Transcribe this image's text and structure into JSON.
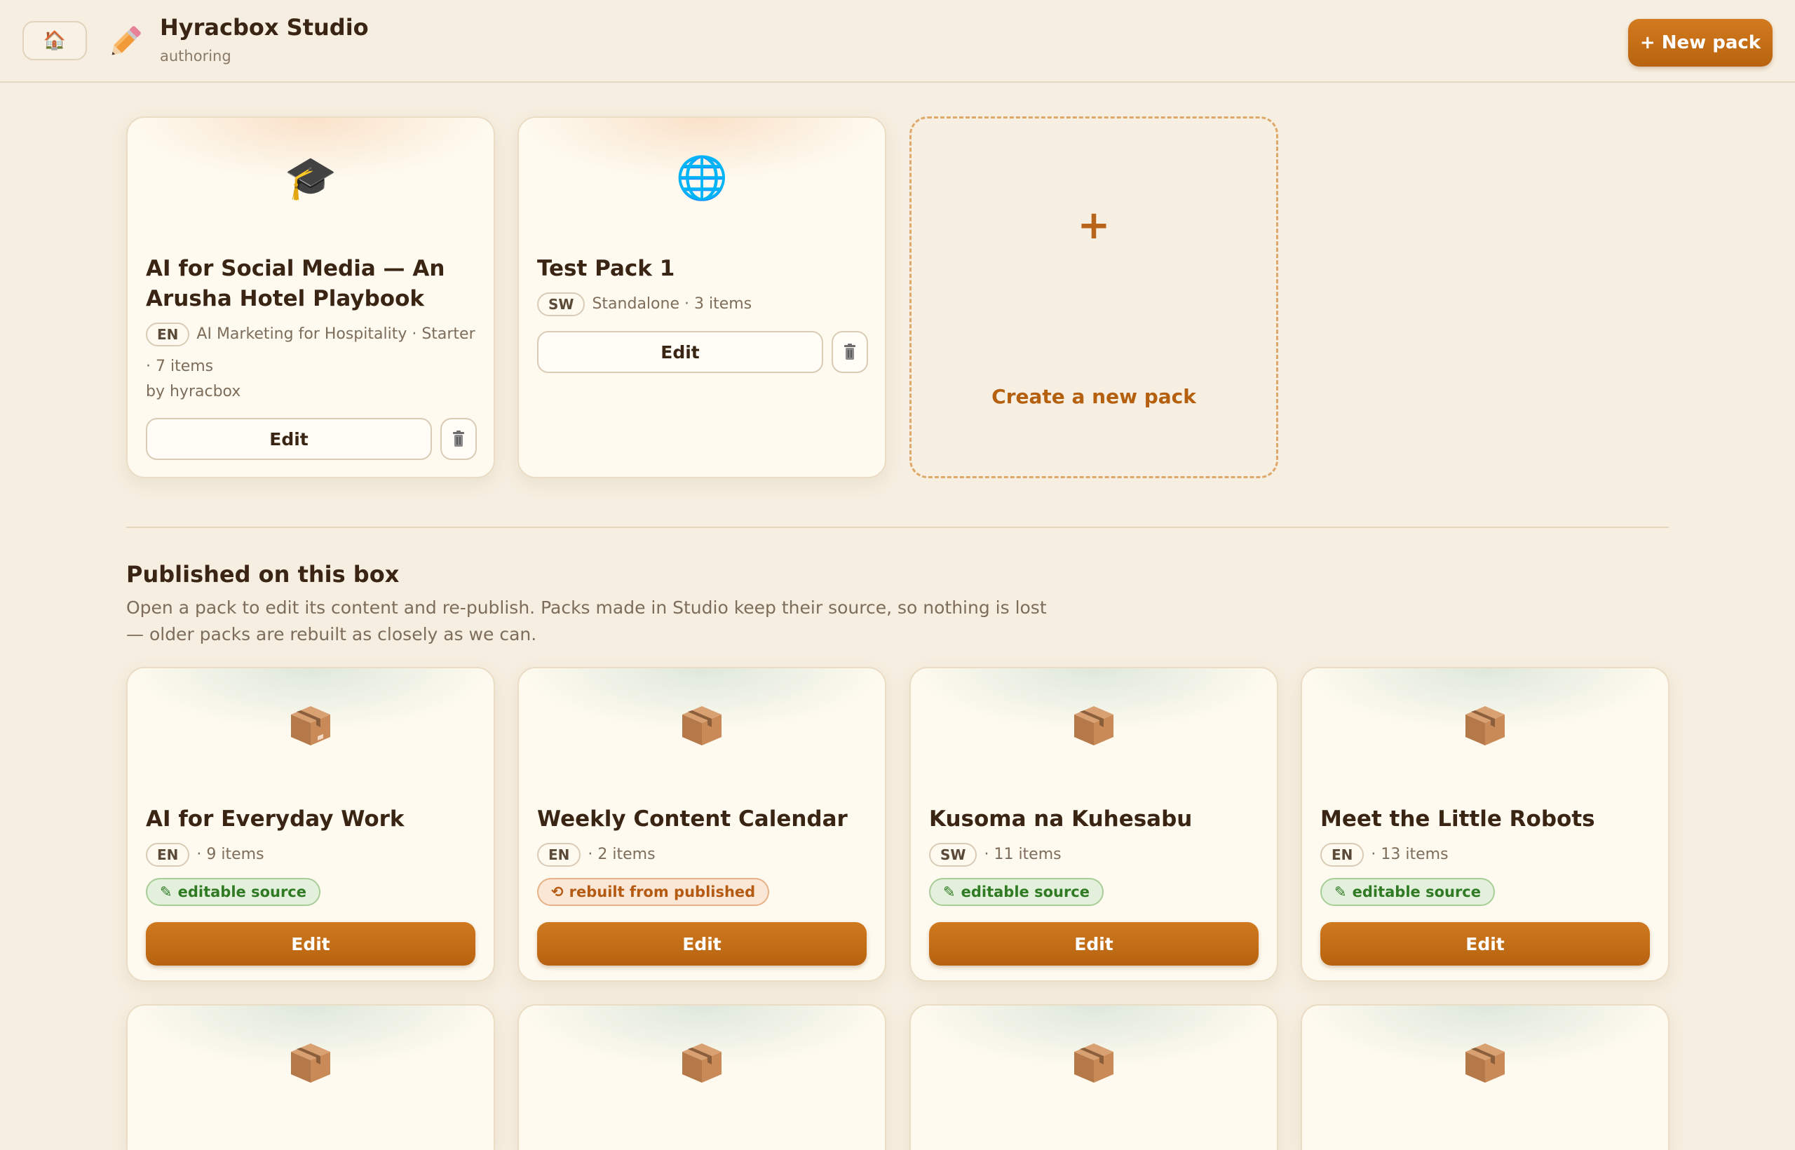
{
  "header": {
    "home_icon": "🏠",
    "brand_icon": "pencil-icon",
    "title": "Hyracbox Studio",
    "subtitle": "authoring",
    "new_pack_label": "+ New pack"
  },
  "drafts": [
    {
      "emoji": "🎓",
      "title": "AI for Social Media — An Arusha Hotel Playbook",
      "lang": "EN",
      "meta_line1": "AI Marketing for Hospitality · Starter",
      "meta_line2": "· 7 items",
      "author": "by hyracbox",
      "edit_label": "Edit"
    },
    {
      "emoji": "🌐",
      "title": "Test Pack 1",
      "lang": "SW",
      "meta_line1": "Standalone · 3 items",
      "edit_label": "Edit"
    }
  ],
  "create_card": {
    "plus": "+",
    "label": "Create a new pack"
  },
  "published_section": {
    "title": "Published on this box",
    "description": "Open a pack to edit its content and re-publish. Packs made in Studio keep their source, so nothing is lost — older packs are rebuilt as closely as we can."
  },
  "published": [
    {
      "title": "AI for Everyday Work",
      "lang": "EN",
      "meta": "· 9 items",
      "badge": "editable source",
      "badge_type": "green",
      "edit_label": "Edit"
    },
    {
      "title": "Weekly Content Calendar",
      "lang": "EN",
      "meta": "· 2 items",
      "badge": "rebuilt from published",
      "badge_type": "orange",
      "edit_label": "Edit"
    },
    {
      "title": "Kusoma na Kuhesabu",
      "lang": "SW",
      "meta": "· 11 items",
      "badge": "editable source",
      "badge_type": "green",
      "edit_label": "Edit"
    },
    {
      "title": "Meet the Little Robots",
      "lang": "EN",
      "meta": "· 13 items",
      "badge": "editable source",
      "badge_type": "green",
      "edit_label": "Edit"
    }
  ],
  "colors": {
    "accent": "#c46d18",
    "background": "#f6eee0",
    "card": "#fefaef",
    "green_badge": "#2f7a23",
    "orange_badge": "#b45a12"
  }
}
